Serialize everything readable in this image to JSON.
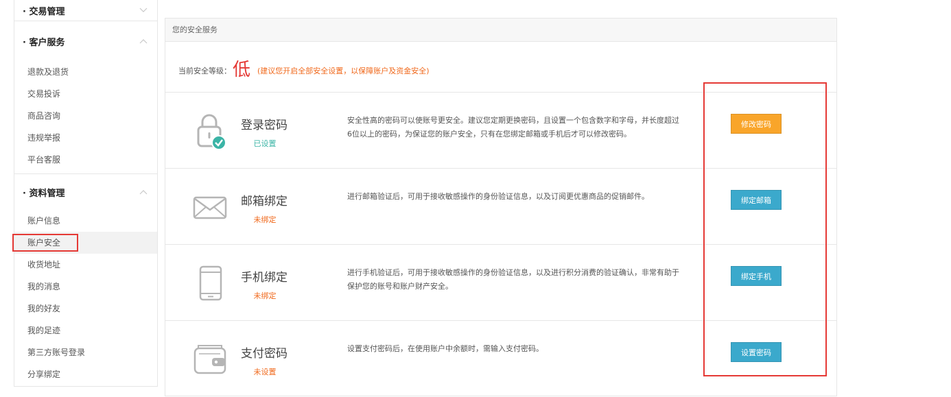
{
  "sidebar": {
    "groups": [
      {
        "title": "· 交易管理",
        "expanded": false,
        "items": []
      },
      {
        "title": "· 客户服务",
        "expanded": true,
        "items": [
          "退款及退货",
          "交易投诉",
          "商品咨询",
          "违规举报",
          "平台客服"
        ]
      },
      {
        "title": "· 资料管理",
        "expanded": true,
        "items": [
          "账户信息",
          "账户安全",
          "收货地址",
          "我的消息",
          "我的好友",
          "我的足迹",
          "第三方账号登录",
          "分享绑定"
        ]
      }
    ],
    "active_item": "账户安全"
  },
  "panel": {
    "title": "您的安全服务",
    "level_label": "当前安全等级：",
    "level_value": "低",
    "level_tip": "(建议您开启全部安全设置，以保障账户及资金安全)"
  },
  "services": [
    {
      "icon": "lock-check-icon",
      "name": "登录密码",
      "status": "已设置",
      "status_ok": true,
      "description": "安全性高的密码可以使账号更安全。建议您定期更换密码，且设置一个包含数字和字母，并长度超过6位以上的密码，为保证您的账户安全，只有在您绑定邮箱或手机后才可以修改密码。",
      "button": "修改密码",
      "button_color": "#f9a52a"
    },
    {
      "icon": "envelope-icon",
      "name": "邮箱绑定",
      "status": "未绑定",
      "status_ok": false,
      "description": "进行邮箱验证后，可用于接收敏感操作的身份验证信息，以及订阅更优惠商品的促销邮件。",
      "button": "绑定邮箱",
      "button_color": "#3ba9cc"
    },
    {
      "icon": "phone-icon",
      "name": "手机绑定",
      "status": "未绑定",
      "status_ok": false,
      "description": "进行手机验证后，可用于接收敏感操作的身份验证信息，以及进行积分消费的验证确认，非常有助于保护您的账号和账户财产安全。",
      "button": "绑定手机",
      "button_color": "#3ba9cc"
    },
    {
      "icon": "wallet-icon",
      "name": "支付密码",
      "status": "未设置",
      "status_ok": false,
      "description": "设置支付密码后，在使用账户中余额时，需输入支付密码。",
      "button": "设置密码",
      "button_color": "#3ba9cc"
    }
  ]
}
